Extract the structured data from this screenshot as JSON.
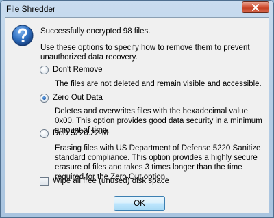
{
  "window": {
    "title": "File Shredder"
  },
  "icons": {
    "info": "question-icon",
    "close": "close-icon"
  },
  "colors": {
    "icon_blue": "#1f5fae",
    "close_red": "#c23b1e",
    "ok_border": "#3c7fb1"
  },
  "message": {
    "success": "Successfully encrypted 98 files.",
    "description": "Use these options to specify how to remove them to prevent unauthorized data recovery."
  },
  "options": [
    {
      "label": "Don't Remove",
      "description": "The files are not deleted and remain visible and accessible.",
      "selected": false
    },
    {
      "label": "Zero Out Data",
      "description": "Deletes and overwrites files with the hexadecimal value 0x00. This option provides good data security in a minimum amount of time.",
      "selected": true
    },
    {
      "label": "DoD 5220.22-M",
      "description": "Erasing files with US Department of Defense 5220 Sanitize standard compliance. This option provides a highly secure erasure of files and takes 3 times longer than the time required for the Zero Out option.",
      "selected": false
    }
  ],
  "wipe_free_space": {
    "label": "Wipe all free (unused) disk space",
    "checked": false
  },
  "buttons": {
    "ok": "OK"
  }
}
